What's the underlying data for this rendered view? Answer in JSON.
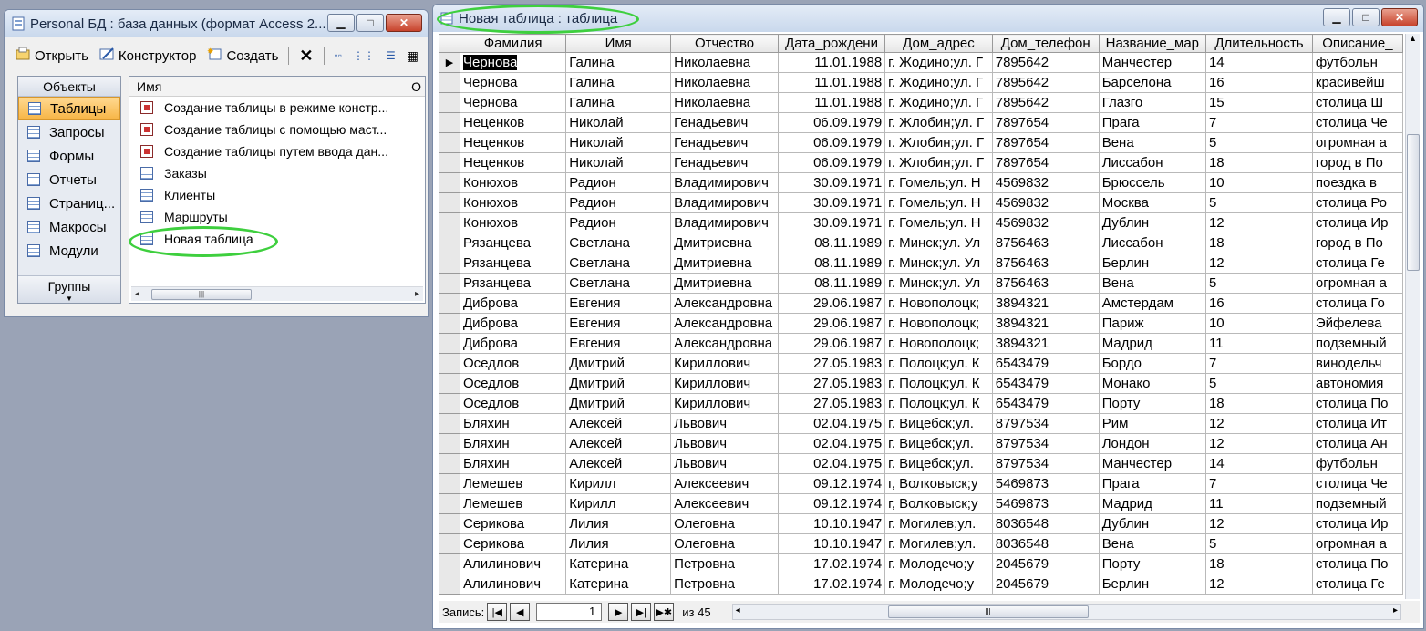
{
  "db_window": {
    "title": "Personal БД : база данных (формат Access 2...",
    "toolbar": {
      "open": "Открыть",
      "designer": "Конструктор",
      "create": "Создать"
    },
    "objects_header": "Объекты",
    "objects": [
      {
        "label": "Таблицы",
        "icon": "table-icon",
        "selected": true
      },
      {
        "label": "Запросы",
        "icon": "query-icon"
      },
      {
        "label": "Формы",
        "icon": "form-icon"
      },
      {
        "label": "Отчеты",
        "icon": "report-icon"
      },
      {
        "label": "Страниц...",
        "icon": "page-icon"
      },
      {
        "label": "Макросы",
        "icon": "macro-icon"
      },
      {
        "label": "Модули",
        "icon": "module-icon"
      }
    ],
    "groups_label": "Группы",
    "list_header_name": "Имя",
    "list_header_extra": "О",
    "list_items": [
      {
        "label": "Создание таблицы в режиме констр...",
        "icon": "wizard-icon"
      },
      {
        "label": "Создание таблицы с помощью маст...",
        "icon": "wizard-icon"
      },
      {
        "label": "Создание таблицы путем ввода дан...",
        "icon": "wizard-icon"
      },
      {
        "label": "Заказы",
        "icon": "table-icon"
      },
      {
        "label": "Клиенты",
        "icon": "table-icon"
      },
      {
        "label": "Маршруты",
        "icon": "table-icon"
      },
      {
        "label": "Новая таблица",
        "icon": "table-icon"
      }
    ]
  },
  "table_window": {
    "title": "Новая таблица : таблица",
    "columns": [
      "Фамилия",
      "Имя",
      "Отчество",
      "Дата_рождени",
      "Дом_адрес",
      "Дом_телефон",
      "Название_мар",
      "Длительность",
      "Описание_"
    ],
    "rows": [
      [
        "Чернова",
        "Галина",
        "Николаевна",
        "11.01.1988",
        "г. Жодино;ул. Г",
        "7895642",
        "Манчестер",
        "14",
        "футбольн"
      ],
      [
        "Чернова",
        "Галина",
        "Николаевна",
        "11.01.1988",
        "г. Жодино;ул. Г",
        "7895642",
        "Барселона",
        "16",
        "красивейш"
      ],
      [
        "Чернова",
        "Галина",
        "Николаевна",
        "11.01.1988",
        "г. Жодино;ул. Г",
        "7895642",
        "Глазго",
        "15",
        "столица Ш"
      ],
      [
        "Неценков",
        "Николай",
        "Генадьевич",
        "06.09.1979",
        "г. Жлобин;ул. Г",
        "7897654",
        "Прага",
        "7",
        "столица Че"
      ],
      [
        "Неценков",
        "Николай",
        "Генадьевич",
        "06.09.1979",
        "г. Жлобин;ул. Г",
        "7897654",
        "Вена",
        "5",
        "огромная а"
      ],
      [
        "Неценков",
        "Николай",
        "Генадьевич",
        "06.09.1979",
        "г. Жлобин;ул. Г",
        "7897654",
        "Лиссабон",
        "18",
        "город в По"
      ],
      [
        "Конюхов",
        "Радион",
        "Владимирович",
        "30.09.1971",
        "г. Гомель;ул. Н",
        "4569832",
        "Брюссель",
        "10",
        "поездка в"
      ],
      [
        "Конюхов",
        "Радион",
        "Владимирович",
        "30.09.1971",
        "г. Гомель;ул. Н",
        "4569832",
        "Москва",
        "5",
        "столица Ро"
      ],
      [
        "Конюхов",
        "Радион",
        "Владимирович",
        "30.09.1971",
        "г. Гомель;ул. Н",
        "4569832",
        "Дублин",
        "12",
        "столица Ир"
      ],
      [
        "Рязанцева",
        "Светлана",
        "Дмитриевна",
        "08.11.1989",
        "г. Минск;ул. Ул",
        "8756463",
        "Лиссабон",
        "18",
        "город в По"
      ],
      [
        "Рязанцева",
        "Светлана",
        "Дмитриевна",
        "08.11.1989",
        "г. Минск;ул. Ул",
        "8756463",
        "Берлин",
        "12",
        "столица Ге"
      ],
      [
        "Рязанцева",
        "Светлана",
        "Дмитриевна",
        "08.11.1989",
        "г. Минск;ул. Ул",
        "8756463",
        "Вена",
        "5",
        "огромная а"
      ],
      [
        "Диброва",
        "Евгения",
        "Александровна",
        "29.06.1987",
        "г. Новополоцк;",
        "3894321",
        "Амстердам",
        "16",
        "столица Го"
      ],
      [
        "Диброва",
        "Евгения",
        "Александровна",
        "29.06.1987",
        "г. Новополоцк;",
        "3894321",
        "Париж",
        "10",
        "Эйфелева"
      ],
      [
        "Диброва",
        "Евгения",
        "Александровна",
        "29.06.1987",
        "г. Новополоцк;",
        "3894321",
        "Мадрид",
        "11",
        "подземный"
      ],
      [
        "Оседлов",
        "Дмитрий",
        "Кириллович",
        "27.05.1983",
        "г. Полоцк;ул. К",
        "6543479",
        "Бордо",
        "7",
        "винодельч"
      ],
      [
        "Оседлов",
        "Дмитрий",
        "Кириллович",
        "27.05.1983",
        "г. Полоцк;ул. К",
        "6543479",
        "Монако",
        "5",
        "автономия"
      ],
      [
        "Оседлов",
        "Дмитрий",
        "Кириллович",
        "27.05.1983",
        "г. Полоцк;ул. К",
        "6543479",
        "Порту",
        "18",
        "столица По"
      ],
      [
        "Бляхин",
        "Алексей",
        "Львович",
        "02.04.1975",
        "г. Вицебск;ул.",
        "8797534",
        "Рим",
        "12",
        "столица Ит"
      ],
      [
        "Бляхин",
        "Алексей",
        "Львович",
        "02.04.1975",
        "г. Вицебск;ул.",
        "8797534",
        "Лондон",
        "12",
        "столица Ан"
      ],
      [
        "Бляхин",
        "Алексей",
        "Львович",
        "02.04.1975",
        "г. Вицебск;ул.",
        "8797534",
        "Манчестер",
        "14",
        "футбольн"
      ],
      [
        "Лемешев",
        "Кирилл",
        "Алексеевич",
        "09.12.1974",
        "г, Волковыск;у",
        "5469873",
        "Прага",
        "7",
        "столица Че"
      ],
      [
        "Лемешев",
        "Кирилл",
        "Алексеевич",
        "09.12.1974",
        "г, Волковыск;у",
        "5469873",
        "Мадрид",
        "11",
        "подземный"
      ],
      [
        "Серикова",
        "Лилия",
        "Олеговна",
        "10.10.1947",
        "г. Могилев;ул.",
        "8036548",
        "Дублин",
        "12",
        "столица Ир"
      ],
      [
        "Серикова",
        "Лилия",
        "Олеговна",
        "10.10.1947",
        "г. Могилев;ул.",
        "8036548",
        "Вена",
        "5",
        "огромная а"
      ],
      [
        "Алилинович",
        "Катерина",
        "Петровна",
        "17.02.1974",
        "г. Молодечо;у",
        "2045679",
        "Порту",
        "18",
        "столица По"
      ],
      [
        "Алилинович",
        "Катерина",
        "Петровна",
        "17.02.1974",
        "г. Молодечо;у",
        "2045679",
        "Берлин",
        "12",
        "столица Ге"
      ]
    ],
    "nav": {
      "record_label": "Запись:",
      "current_record": "1",
      "of_label": "из 45"
    }
  },
  "colors": {
    "highlight_ellipse": "#3ecf3e",
    "selected_object": "#f7b545"
  }
}
